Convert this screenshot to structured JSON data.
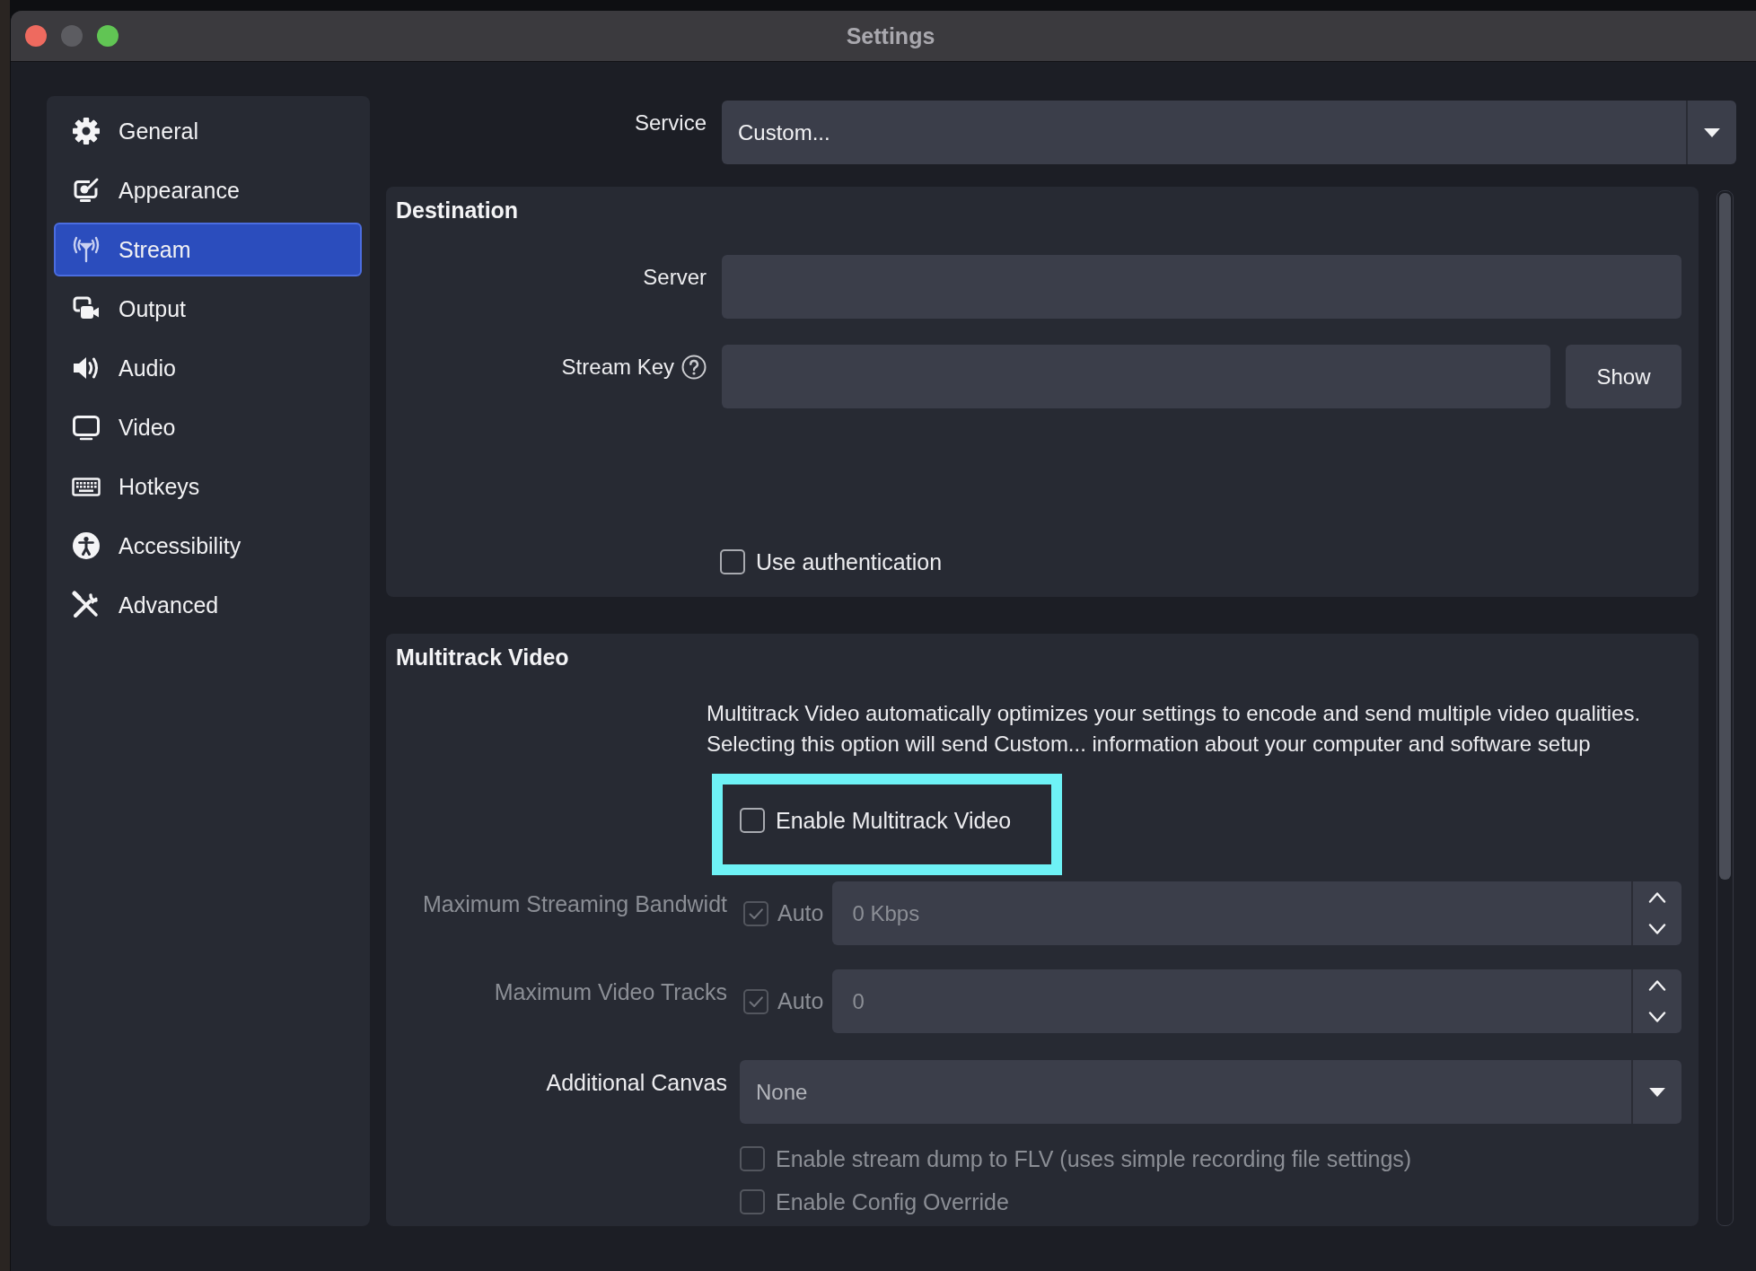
{
  "window": {
    "title": "Settings",
    "controls": [
      {
        "kind": "close",
        "disabled": false
      },
      {
        "kind": "minimize",
        "disabled": true
      },
      {
        "kind": "zoom",
        "disabled": false
      }
    ]
  },
  "sidebar": {
    "items": [
      {
        "label": "General",
        "selected": false
      },
      {
        "label": "Appearance",
        "selected": false
      },
      {
        "label": "Stream",
        "selected": true
      },
      {
        "label": "Output",
        "selected": false
      },
      {
        "label": "Audio",
        "selected": false
      },
      {
        "label": "Video",
        "selected": false
      },
      {
        "label": "Hotkeys",
        "selected": false
      },
      {
        "label": "Accessibility",
        "selected": false
      },
      {
        "label": "Advanced",
        "selected": false
      }
    ]
  },
  "service": {
    "label": "Service",
    "value": "Custom..."
  },
  "destination": {
    "title": "Destination",
    "server": {
      "label": "Server"
    },
    "stream_key": {
      "label": "Stream Key",
      "button": "Show"
    },
    "use_authentication": {
      "label": "Use authentication",
      "checked": false
    }
  },
  "multitrack": {
    "title": "Multitrack Video",
    "description": "Multitrack Video automatically optimizes your settings to encode and send multiple video qualities. Selecting this option will send Custom... information about your computer and software setup",
    "enable": {
      "label": "Enable Multitrack Video",
      "checked": false,
      "highlighted": true
    },
    "rows": [
      {
        "kind": "spin",
        "label": "Maximum Streaming Bandwidt",
        "disabled": true,
        "auto": {
          "label": "Auto",
          "checked": true
        },
        "value": "0 Kbps"
      },
      {
        "kind": "spin",
        "label": "Maximum Video Tracks",
        "disabled": true,
        "auto": {
          "label": "Auto",
          "checked": true
        },
        "value": "0"
      },
      {
        "kind": "combo",
        "label": "Additional Canvas",
        "disabled": false,
        "value": "None"
      }
    ],
    "options": [
      {
        "label": "Enable stream dump to FLV (uses simple recording file settings)",
        "checked": false,
        "disabled": true
      },
      {
        "label": "Enable Config Override",
        "checked": false,
        "disabled": true
      }
    ]
  }
}
